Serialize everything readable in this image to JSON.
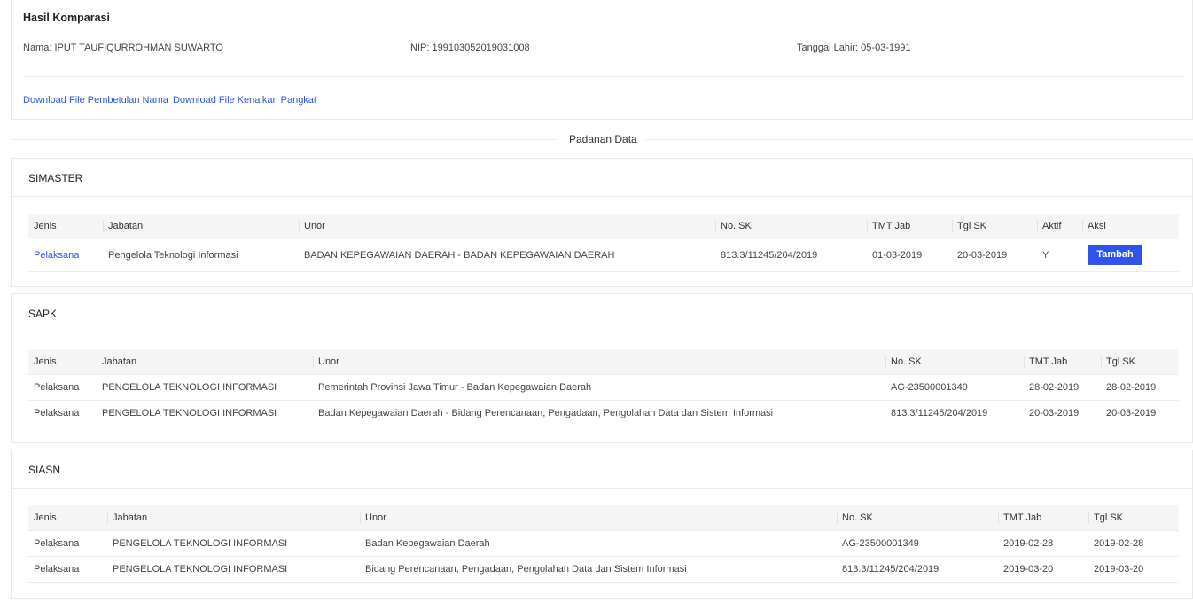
{
  "header": {
    "title": "Hasil Komparasi",
    "nama_label": "Nama:",
    "nama_value": "IPUT TAUFIQURROHMAN SUWARTO",
    "nip_label": "NIP:",
    "nip_value": "199103052019031008",
    "tgl_label": "Tanggal Lahir:",
    "tgl_value": "05-03-1991",
    "link_pembetulan": "Download File Pembetulan Nama",
    "link_kenaikan": "Download File Kenaikan Pangkat"
  },
  "divider_label": "Padanan Data",
  "simaster": {
    "title": "SIMASTER",
    "columns": [
      "Jenis",
      "Jabatan",
      "Unor",
      "No. SK",
      "TMT Jab",
      "Tgl SK",
      "Aktif",
      "Aksi"
    ],
    "rows": [
      {
        "jenis": "Pelaksana",
        "jabatan": "Pengelola Teknologi Informasi",
        "unor": "BADAN KEPEGAWAIAN DAERAH - BADAN KEPEGAWAIAN DAERAH",
        "no_sk": "813.3/11245/204/2019",
        "tmt_jab": "01-03-2019",
        "tgl_sk": "20-03-2019",
        "aktif": "Y",
        "aksi_label": "Tambah"
      }
    ]
  },
  "sapk": {
    "title": "SAPK",
    "columns": [
      "Jenis",
      "Jabatan",
      "Unor",
      "No. SK",
      "TMT Jab",
      "Tgl SK"
    ],
    "rows": [
      {
        "jenis": "Pelaksana",
        "jabatan": "PENGELOLA TEKNOLOGI INFORMASI",
        "unor": "Pemerintah Provinsi Jawa Timur - Badan Kepegawaian Daerah",
        "no_sk": "AG-23500001349",
        "tmt_jab": "28-02-2019",
        "tgl_sk": "28-02-2019"
      },
      {
        "jenis": "Pelaksana",
        "jabatan": "PENGELOLA TEKNOLOGI INFORMASI",
        "unor": "Badan Kepegawaian Daerah - Bidang Perencanaan, Pengadaan, Pengolahan Data dan Sistem Informasi",
        "no_sk": "813.3/11245/204/2019",
        "tmt_jab": "20-03-2019",
        "tgl_sk": "20-03-2019"
      }
    ]
  },
  "siasn": {
    "title": "SIASN",
    "columns": [
      "Jenis",
      "Jabatan",
      "Unor",
      "No. SK",
      "TMT Jab",
      "Tgl SK"
    ],
    "rows": [
      {
        "jenis": "Pelaksana",
        "jabatan": "PENGELOLA TEKNOLOGI INFORMASI",
        "unor": "Badan Kepegawaian Daerah",
        "no_sk": "AG-23500001349",
        "tmt_jab": "2019-02-28",
        "tgl_sk": "2019-02-28"
      },
      {
        "jenis": "Pelaksana",
        "jabatan": "PENGELOLA TEKNOLOGI INFORMASI",
        "unor": "Bidang Perencanaan, Pengadaan, Pengolahan Data dan Sistem Informasi",
        "no_sk": "813.3/11245/204/2019",
        "tmt_jab": "2019-03-20",
        "tgl_sk": "2019-03-20"
      }
    ]
  },
  "colors": {
    "link": "#2f54eb",
    "primary_button": "#2f54eb",
    "header_bg": "#f5f5f5"
  }
}
